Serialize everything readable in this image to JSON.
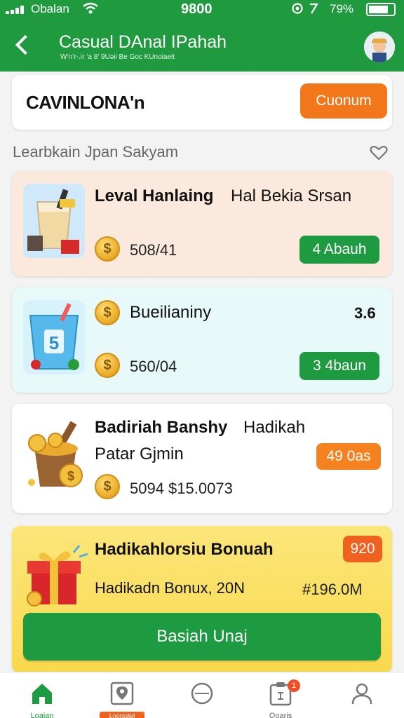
{
  "status_bar": {
    "carrier": "Obalan",
    "time": "9800",
    "battery": "79%",
    "battery_level": 0.79
  },
  "header": {
    "title": "Casual DAnal IPahah",
    "subtitle": "W’n’r-.ir ’a 8’ 9Uəii Be Goc KUnoiaeit"
  },
  "top_card": {
    "name": "CAVINLONA'n",
    "button_label": "Cuonum"
  },
  "section": {
    "title": "Learbkain Jpan Sakyam"
  },
  "cards": [
    {
      "title_bold": "Leval Hanlaing",
      "title_rest": "Hal Bekia Srsan",
      "value": "508/41",
      "button_label": "4 Abauh"
    },
    {
      "title": "Bueilianiny",
      "right_value": "3.6",
      "value": "560/04",
      "button_label": "3 4baun"
    },
    {
      "title_bold": "Badiriah Banshy",
      "title_rest": "Hadikah",
      "subtitle": "Patar Gjmin",
      "value": "5094 $15.0073",
      "badge": "49 0as"
    },
    {
      "title": "Hadikahlorsiu Bonuah",
      "badge": "920",
      "subtitle": "Hadikadn Bonux, 20N",
      "right_value": "#196.0M",
      "button_label": "Basiah Unaj"
    }
  ],
  "bottom_nav": [
    {
      "label": "Loaian",
      "icon": "home-icon",
      "active": true
    },
    {
      "label": "Lnorsstel",
      "icon": "location-card-icon",
      "highlight": true
    },
    {
      "label": "",
      "icon": "circle-icon"
    },
    {
      "label": "Qoaris",
      "icon": "clipboard-icon",
      "badge": "1"
    },
    {
      "label": "",
      "icon": "profile-icon"
    }
  ],
  "colors": {
    "primary_green": "#1f9a3f",
    "accent_orange": "#f2771a",
    "card_peach": "#fbe9de",
    "card_mint": "#e7faf9",
    "card_yellow": "#fbe06a"
  }
}
